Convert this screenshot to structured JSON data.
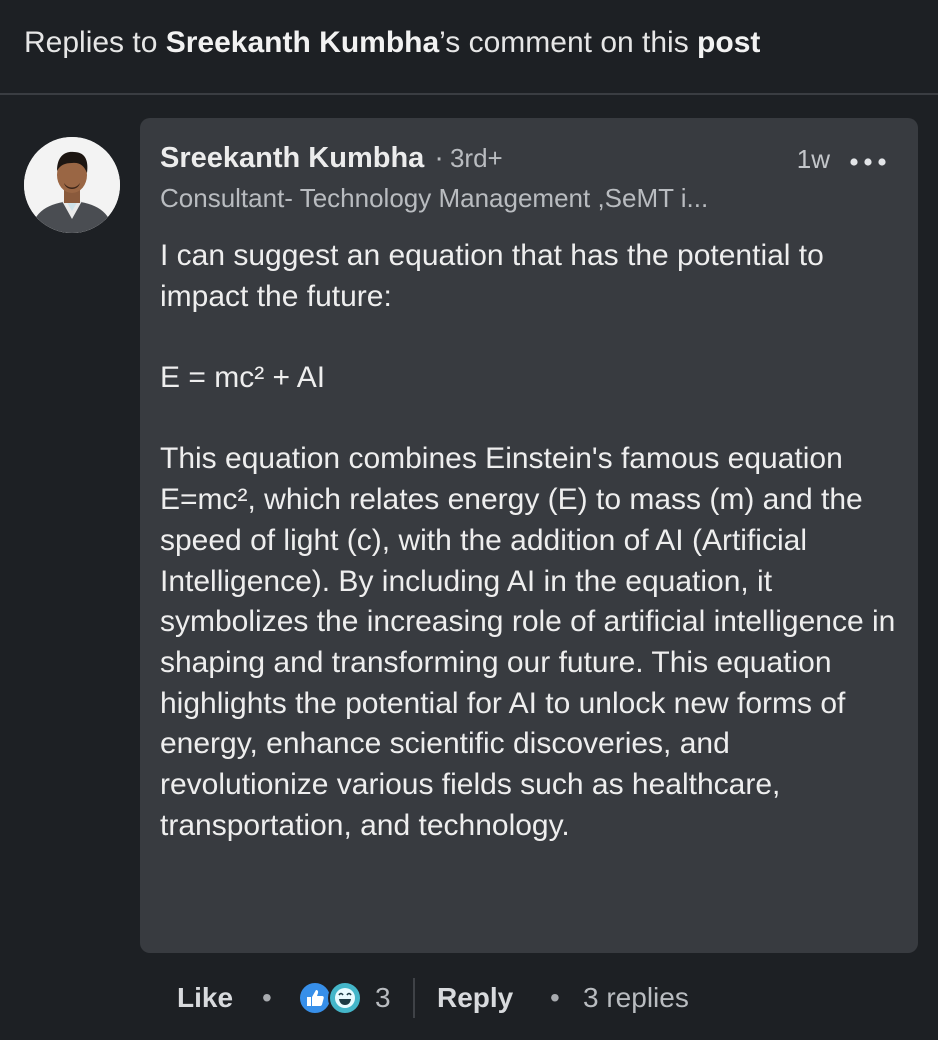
{
  "header": {
    "prefix": "Replies to ",
    "author": "Sreekanth Kumbha",
    "middle": "’s comment on this ",
    "post_link": "post"
  },
  "comment": {
    "author_name": "Sreekanth Kumbha",
    "separator": "·",
    "degree": "3rd+",
    "time": "1w",
    "headline": "Consultant- Technology Management ,SeMT i...",
    "paragraphs": [
      "I can suggest an equation that has the potential to impact the future:",
      "E = mc² + AI",
      "This equation combines Einstein's famous equation E=mc², which relates energy (E) to mass (m) and the speed of light (c), with the addition of AI (Artificial Intelligence). By including AI in the equation, it symbolizes the increasing role of artificial intelligence in shaping and transforming our future. This equation highlights the potential for AI to unlock new forms of energy, enhance scientific discoveries, and revolutionize various fields such as healthcare, transportation, and technology."
    ]
  },
  "actions": {
    "like_label": "Like",
    "dot": "•",
    "reaction_count": "3",
    "reactions": [
      "like-icon",
      "funny-icon"
    ],
    "reply_label": "Reply",
    "replies_label": "3 replies"
  },
  "colors": {
    "background": "#1d2024",
    "bubble": "#383b40",
    "like_blue": "#378fe9",
    "funny_teal": "#44b6c9"
  }
}
